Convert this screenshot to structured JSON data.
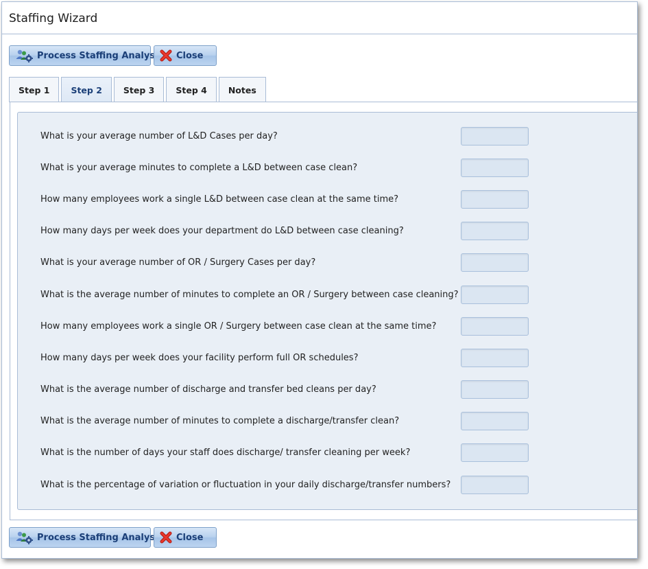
{
  "window": {
    "title": "Staffing Wizard"
  },
  "toolbar_top": {
    "process_label": "Process Staffing Analysis",
    "close_label": "Close"
  },
  "toolbar_bottom": {
    "process_label": "Process Staffing Analysis",
    "close_label": "Close"
  },
  "tabs": [
    {
      "label": "Step 1",
      "active": false
    },
    {
      "label": "Step 2",
      "active": true
    },
    {
      "label": "Step 3",
      "active": false
    },
    {
      "label": "Step 4",
      "active": false
    },
    {
      "label": "Notes",
      "active": false
    }
  ],
  "questions": [
    {
      "label": "What is your average number of L&D Cases per day?",
      "value": ""
    },
    {
      "label": "What is your average minutes to complete a L&D between case clean?",
      "value": ""
    },
    {
      "label": "How many employees work a single L&D between case clean at the same time?",
      "value": ""
    },
    {
      "label": "How many days per week does your department do L&D between case cleaning?",
      "value": ""
    },
    {
      "label": "What is your average number of OR / Surgery Cases per day?",
      "value": ""
    },
    {
      "label": "What is the average number of minutes to complete an OR / Surgery between case cleaning?",
      "value": ""
    },
    {
      "label": "How many employees work a single OR / Surgery between case clean at the same time?",
      "value": ""
    },
    {
      "label": "How many days per week does your facility perform full OR schedules?",
      "value": ""
    },
    {
      "label": "What is the average number of discharge and transfer bed cleans per day?",
      "value": ""
    },
    {
      "label": "What is the average number of minutes to complete a discharge/transfer clean?",
      "value": ""
    },
    {
      "label": "What is the number of days your staff does discharge/ transfer cleaning per week?",
      "value": ""
    },
    {
      "label": "What is the percentage of variation or fluctuation in your daily discharge/transfer numbers?",
      "value": ""
    }
  ],
  "icons": {
    "process": "users-gear-icon",
    "close": "red-x-icon"
  },
  "colors": {
    "accent": "#1b3f78",
    "border": "#a9bcd6",
    "panel": "#e9eff6",
    "close_x": "#d9241b"
  }
}
